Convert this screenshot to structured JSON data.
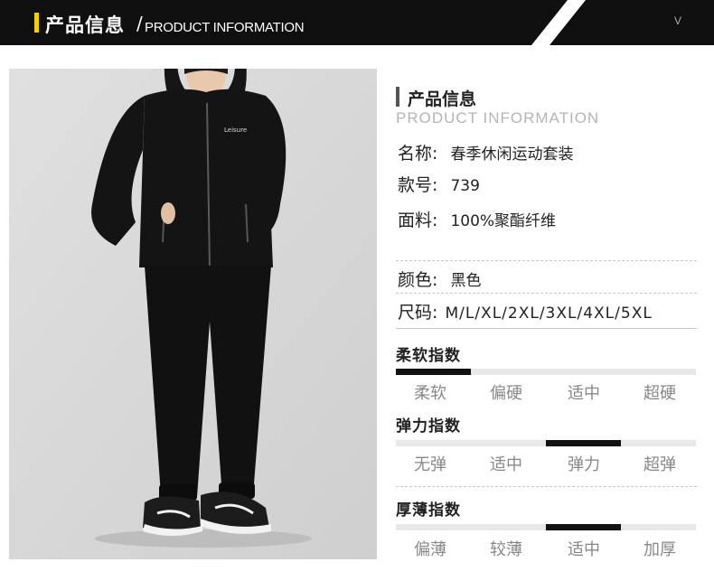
{
  "header": {
    "title_cn": "产品信息",
    "slash": "/",
    "title_en": "PRODUCT INFORMATION",
    "corner_mark": "V"
  },
  "info": {
    "title_cn": "产品信息",
    "title_en": "PRODUCT INFORMATION",
    "rows": [
      {
        "key": "名称:",
        "value": "春季休闲运动套装"
      },
      {
        "key": "款号:",
        "value": "739"
      },
      {
        "key": "面料:",
        "value": "100%聚酯纤维"
      },
      {
        "key": "颜色:",
        "value": "黑色"
      },
      {
        "key": "尺码:",
        "value": "M/L/XL/2XL/3XL/4XL/5XL"
      }
    ]
  },
  "scales": [
    {
      "title": "柔软指数",
      "labels": [
        "柔软",
        "偏硬",
        "适中",
        "超硬"
      ],
      "selected_index": 0
    },
    {
      "title": "弹力指数",
      "labels": [
        "无弹",
        "适中",
        "弹力",
        "超弹"
      ],
      "selected_index": 2
    },
    {
      "title": "厚薄指数",
      "labels": [
        "偏薄",
        "较薄",
        "适中",
        "加厚"
      ],
      "selected_index": 2
    }
  ],
  "photo": {
    "jacket_logo": "Leisure",
    "colors": {
      "background": "#d8d8d8",
      "garment": "#141414",
      "accent": "#f5d000"
    }
  }
}
